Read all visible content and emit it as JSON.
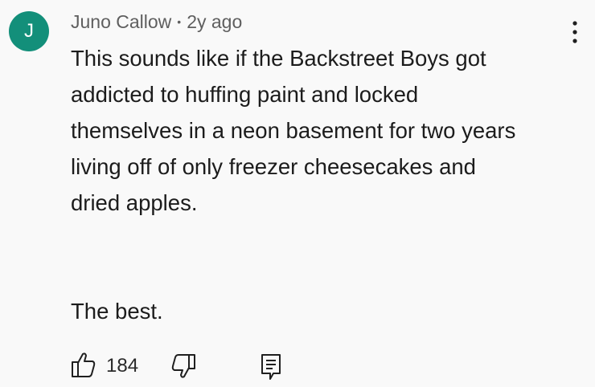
{
  "theme": {
    "avatar_bg": "#138f7a",
    "text_color": "#1c1c1c",
    "meta_color": "#5f5f5f",
    "background": "#f9f9f9"
  },
  "comment": {
    "avatar_initial": "J",
    "author": "Juno Callow",
    "separator": "•",
    "time_ago": "2y ago",
    "lines": [
      "This sounds like if the Backstreet Boys got",
      "addicted to huffing paint and locked",
      "themselves in a neon basement for two years",
      "living off of only freezer cheesecakes and",
      "dried apples."
    ],
    "closing_line": "The best.",
    "like_count": "184"
  },
  "icons": {
    "menu": "more-vertical-icon",
    "like": "thumbs-up-icon",
    "dislike": "thumbs-down-icon",
    "reply": "reply-comment-icon"
  }
}
